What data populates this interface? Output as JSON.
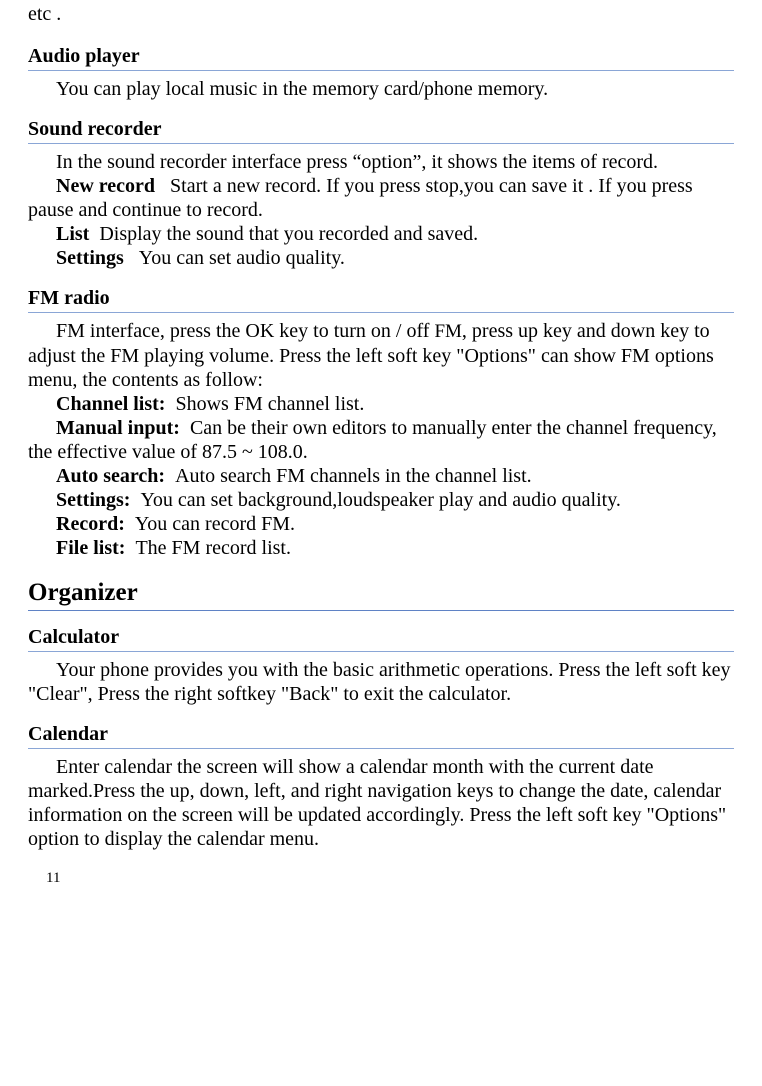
{
  "orphan_line": "etc .",
  "sections": {
    "audio_player": {
      "heading": "Audio player",
      "body": "You can play local music in the memory card/phone memory."
    },
    "sound_recorder": {
      "heading": "Sound recorder",
      "intro": "In the sound recorder interface press “option”, it shows the items of record.",
      "new_record_label": "New record",
      "new_record_text": "   Start a new record. If you press stop,you can save it . If you press pause and continue to record.",
      "list_label": "List",
      "list_text": "  Display the sound that you recorded and saved.",
      "settings_label": "Settings",
      "settings_text": "   You can set audio quality."
    },
    "fm_radio": {
      "heading": "FM radio",
      "intro_part1": "FM interface, press the OK key to turn on / off ",
      "intro_fm": "FM",
      "intro_part2": ", press up key and down key to adjust the FM playing volume. Press the left soft key \"Options\" can show FM options menu, the contents as follow:",
      "channel_list_label": "Channel list:",
      "channel_list_text": "  Shows FM channel list.",
      "manual_input_label": "Manual input:",
      "manual_input_text": "  Can be their own editors to manually enter the channel frequency, the effective value of 87.5 ~ 108.0.",
      "auto_search_label": "Auto search:",
      "auto_search_text": "  Auto search FM channels in the channel list.",
      "settings_label": "Settings:",
      "settings_text": "  You can set background,loudspeaker play and audio quality.",
      "record_label": "Record:",
      "record_text": "  You can record FM.",
      "file_list_label": "File list:",
      "file_list_text": "  The FM record list."
    },
    "organizer": {
      "heading": "Organizer"
    },
    "calculator": {
      "heading": "Calculator",
      "body": "Your phone provides you with the basic arithmetic operations. Press the left soft key \"Clear\", Press the right softkey \"Back\" to exit the calculator."
    },
    "calendar": {
      "heading": "Calendar",
      "body": "Enter calendar the screen will show a calendar month with the current date marked.Press the up, down, left, and right navigation keys to change the date, calendar information on the screen will be updated accordingly. Press the left soft key \"Options\" option to display the calendar menu."
    }
  },
  "page_number": "11"
}
